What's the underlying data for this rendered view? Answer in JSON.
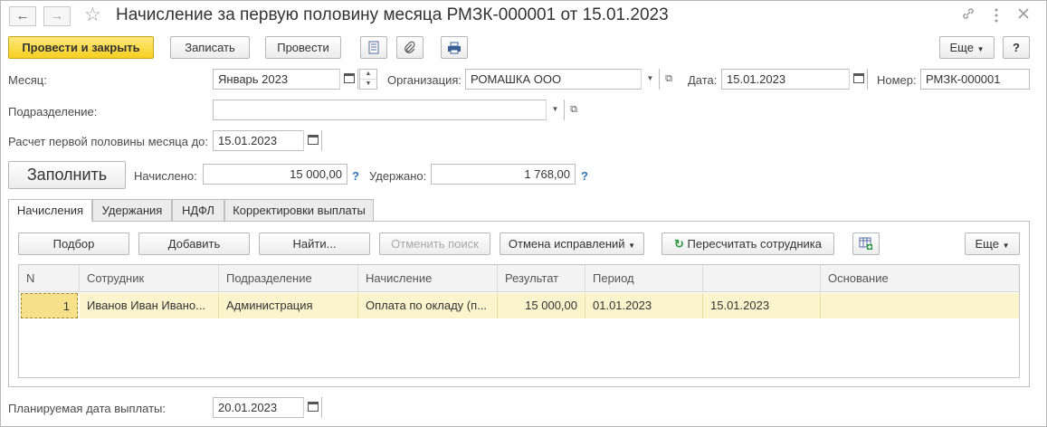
{
  "window": {
    "title": "Начисление за первую половину месяца РМЗК-000001 от 15.01.2023"
  },
  "toolbar": {
    "post_close": "Провести и закрыть",
    "save": "Записать",
    "post": "Провести",
    "more": "Еще",
    "help": "?"
  },
  "form": {
    "month_label": "Месяц:",
    "month_value": "Январь 2023",
    "org_label": "Организация:",
    "org_value": "РОМАШКА ООО",
    "date_label": "Дата:",
    "date_value": "15.01.2023",
    "number_label": "Номер:",
    "number_value": "РМЗК-000001",
    "department_label": "Подразделение:",
    "department_value": "",
    "calc_until_label": "Расчет первой половины месяца до:",
    "calc_until_value": "15.01.2023",
    "fill_button": "Заполнить",
    "accrued_label": "Начислено:",
    "accrued_value": "15 000,00",
    "withheld_label": "Удержано:",
    "withheld_value": "1 768,00",
    "help_mark": "?",
    "pay_date_label": "Планируемая дата выплаты:",
    "pay_date_value": "20.01.2023"
  },
  "tabs": [
    {
      "label": "Начисления"
    },
    {
      "label": "Удержания"
    },
    {
      "label": "НДФЛ"
    },
    {
      "label": "Корректировки выплаты"
    }
  ],
  "tab_toolbar": {
    "pick": "Подбор",
    "add": "Добавить",
    "find": "Найти...",
    "cancel_search": "Отменить поиск",
    "cancel_fixes": "Отмена исправлений",
    "recalc": "Пересчитать сотрудника",
    "more": "Еще"
  },
  "table": {
    "headers": [
      "N",
      "Сотрудник",
      "Подразделение",
      "Начисление",
      "Результат",
      "Период",
      "",
      "Основание"
    ],
    "rows": [
      {
        "n": "1",
        "employee": "Иванов Иван Ивано...",
        "department": "Администрация",
        "accrual": "Оплата по окладу (п...",
        "result": "15 000,00",
        "period_from": "01.01.2023",
        "period_to": "15.01.2023",
        "basis": ""
      }
    ]
  },
  "icons": {
    "back": "arrow-left-icon",
    "forward": "arrow-right-icon",
    "favorite": "star-icon",
    "link": "link-icon",
    "menu": "more-vertical-icon",
    "close": "close-icon",
    "report": "document-icon",
    "attach": "paperclip-icon",
    "print": "printer-icon",
    "calendar": "calendar-icon",
    "refresh": "refresh-icon",
    "grid_add": "table-add-icon"
  },
  "colors": {
    "primary_button": "#f6cf22",
    "selected_row": "#fbf4cc",
    "help_link": "#2d73b9",
    "recalc_icon": "#2e9a40"
  }
}
